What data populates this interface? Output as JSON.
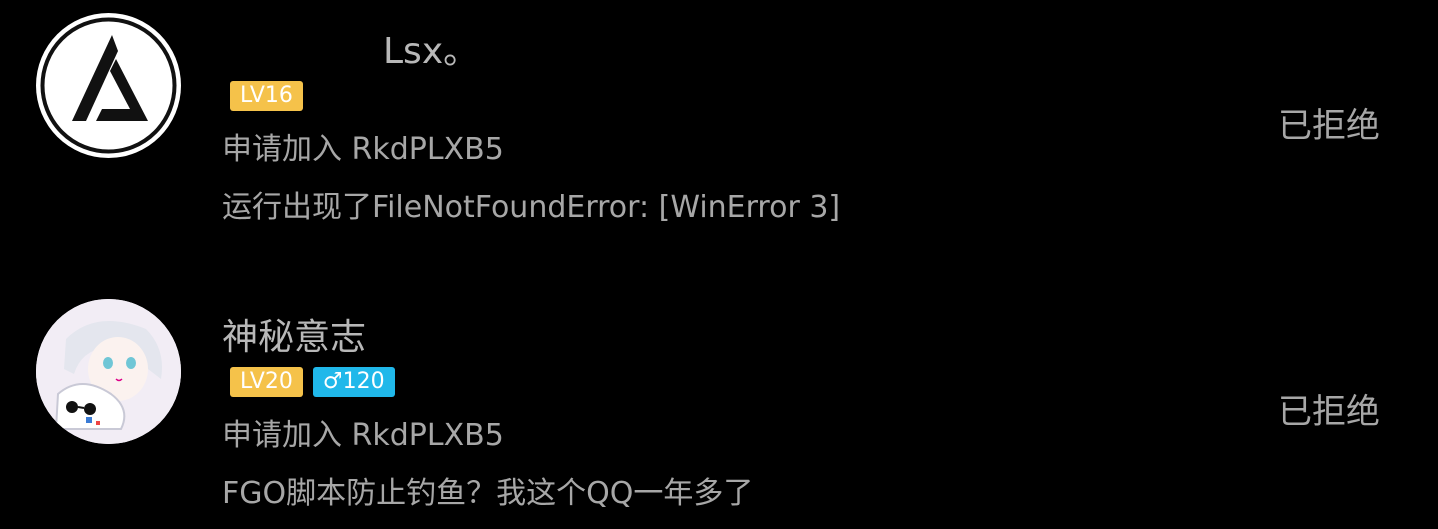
{
  "requests": [
    {
      "name": "Lsx。",
      "level": "LV16",
      "gender_badge": "",
      "apply_text": "申请加入 RkdPLXB5",
      "message": "运行出现了FileNotFoundError: [WinError 3]",
      "status": "已拒绝",
      "avatar_icon": "linkin-park-logo-icon"
    },
    {
      "name": "神秘意志",
      "level": "LV20",
      "gender_badge": "♂120",
      "apply_text": "申请加入 RkdPLXB5",
      "message": "FGO脚本防止钓鱼？我这个QQ一年多了",
      "status": "已拒绝",
      "avatar_icon": "anime-avatar-icon"
    }
  ],
  "colors": {
    "background": "#000000",
    "text": "#a7a7a7",
    "level_badge": "#f5c24a",
    "gender_badge": "#20b8ea"
  }
}
